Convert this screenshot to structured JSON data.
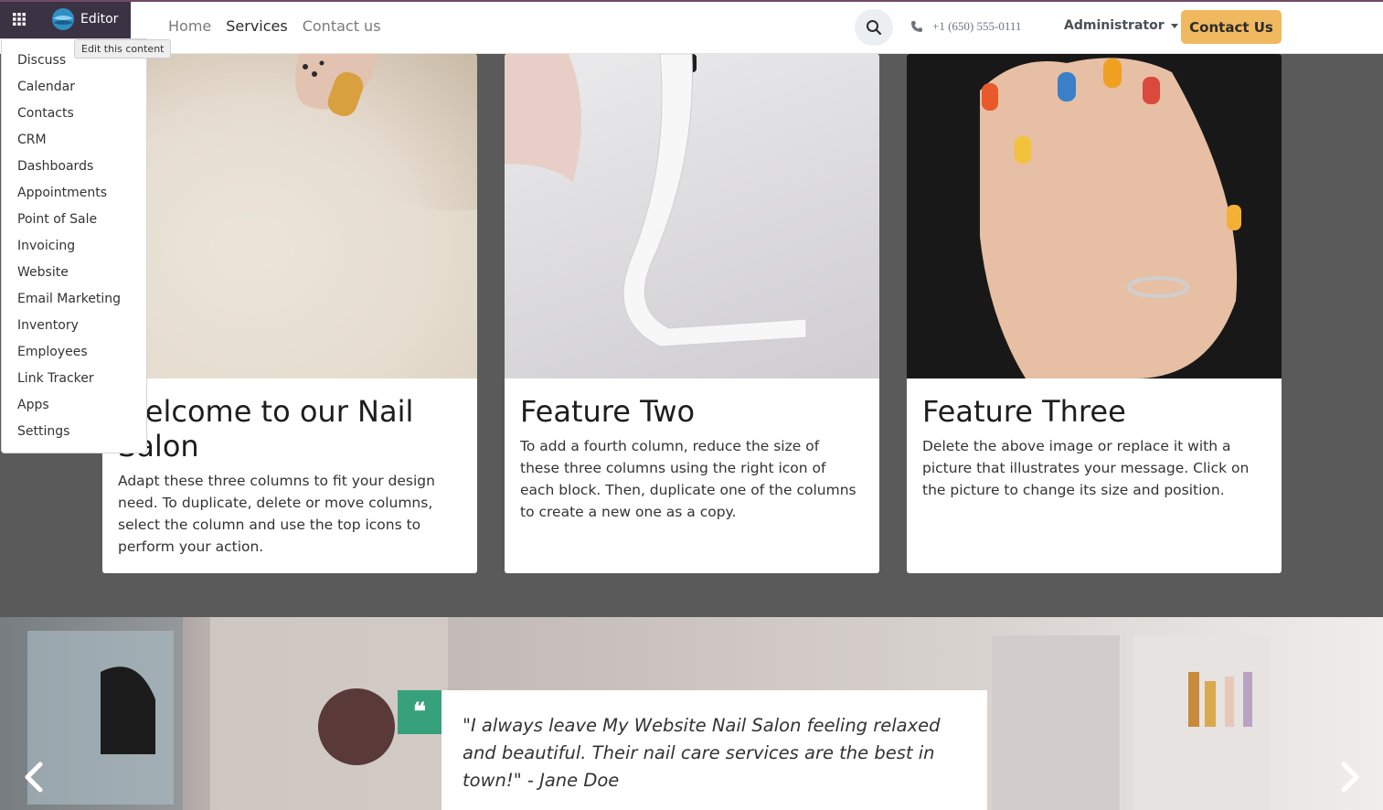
{
  "editor": {
    "label": "Editor",
    "tooltip": "Edit this content"
  },
  "nav": {
    "links": [
      "Home",
      "Services",
      "Contact us"
    ],
    "phone": "+1 (650) 555-0111",
    "user": "Administrator",
    "cta": "Contact Us"
  },
  "apps_menu": [
    "Discuss",
    "Calendar",
    "Contacts",
    "CRM",
    "Dashboards",
    "Appointments",
    "Point of Sale",
    "Invoicing",
    "Website",
    "Email Marketing",
    "Inventory",
    "Employees",
    "Link Tracker",
    "Apps",
    "Settings"
  ],
  "cards": [
    {
      "title": "Welcome to our Nail Salon",
      "text": "Adapt these three columns to fit your design need. To duplicate, delete or move columns, select the column and use the top icons to perform your action."
    },
    {
      "title": "Feature Two",
      "text": "To add a fourth column, reduce the size of these three columns using the right icon of each block. Then, duplicate one of the columns to create a new one as a copy."
    },
    {
      "title": "Feature Three",
      "text": "Delete the above image or replace it with a picture that illustrates your message. Click on the picture to change its size and position."
    }
  ],
  "testimonial": {
    "quote": "\"I always leave My Website Nail Salon feeling relaxed and beautiful. Their nail care services are the best in town!\" - Jane Doe",
    "badge": "❝"
  },
  "colors": {
    "accent": "#f0b960",
    "brand": "#714b67",
    "quote_badge": "#36a17a"
  }
}
